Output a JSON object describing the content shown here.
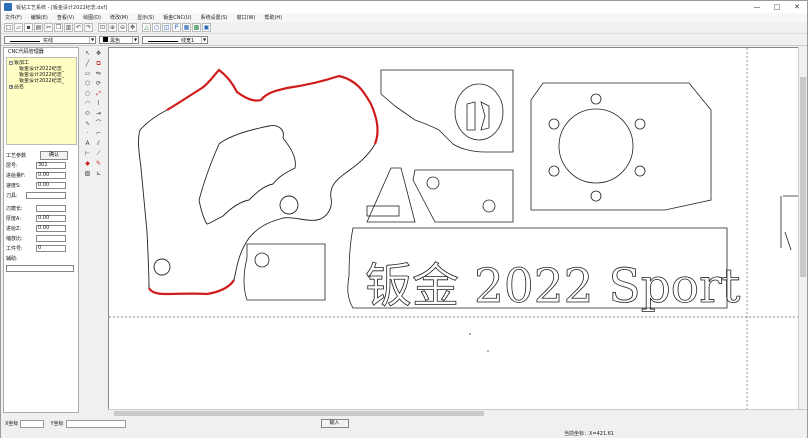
{
  "window": {
    "title": "钣钻工艺系统 - [钣金设计2022纪念.dxf]",
    "controls": {
      "minimize": "—",
      "maximize": "□",
      "close": "✕"
    }
  },
  "menu": [
    "文件(F)",
    "编辑(E)",
    "查看(V)",
    "绘图(D)",
    "修改(M)",
    "显示(S)",
    "钣金CNC(U)",
    "系统设置(S)",
    "窗口(W)",
    "帮助(H)"
  ],
  "toolbar2": {
    "linetype_label": "实线",
    "color_label": "黑色",
    "layer_label": "线宽1"
  },
  "tree": {
    "header": "CNC代码管理器",
    "root_label": "钣加工",
    "children": [
      "钣金设计2022纪念_",
      "钣金设计2022纪念_",
      "钣金设计2022纪念_"
    ],
    "root2_label": "品名"
  },
  "params": {
    "title": "工艺参数",
    "confirm_label": "确认",
    "rows": [
      {
        "label": "层号:",
        "value": "301"
      },
      {
        "label": "进给量F:",
        "value": "0.00"
      },
      {
        "label": "速度S:",
        "value": "0.00"
      },
      {
        "label": "刀具:",
        "value": ""
      },
      {
        "label": "刃磨长:",
        "value": ""
      },
      {
        "label": "厚度A:",
        "value": "0.00"
      },
      {
        "label": "进给Z:",
        "value": "0.00"
      },
      {
        "label": "缩放比:",
        "value": ""
      },
      {
        "label": "工件号:",
        "value": "0"
      },
      {
        "label": "辅助:",
        "value": ""
      }
    ]
  },
  "canvas": {
    "banner_text": "钣金 2022 Sport"
  },
  "status": {
    "x_label": "X坐标",
    "y_label": "Y坐标",
    "input_label": "输入",
    "coord_readout": "当前坐标：X=421.61"
  }
}
